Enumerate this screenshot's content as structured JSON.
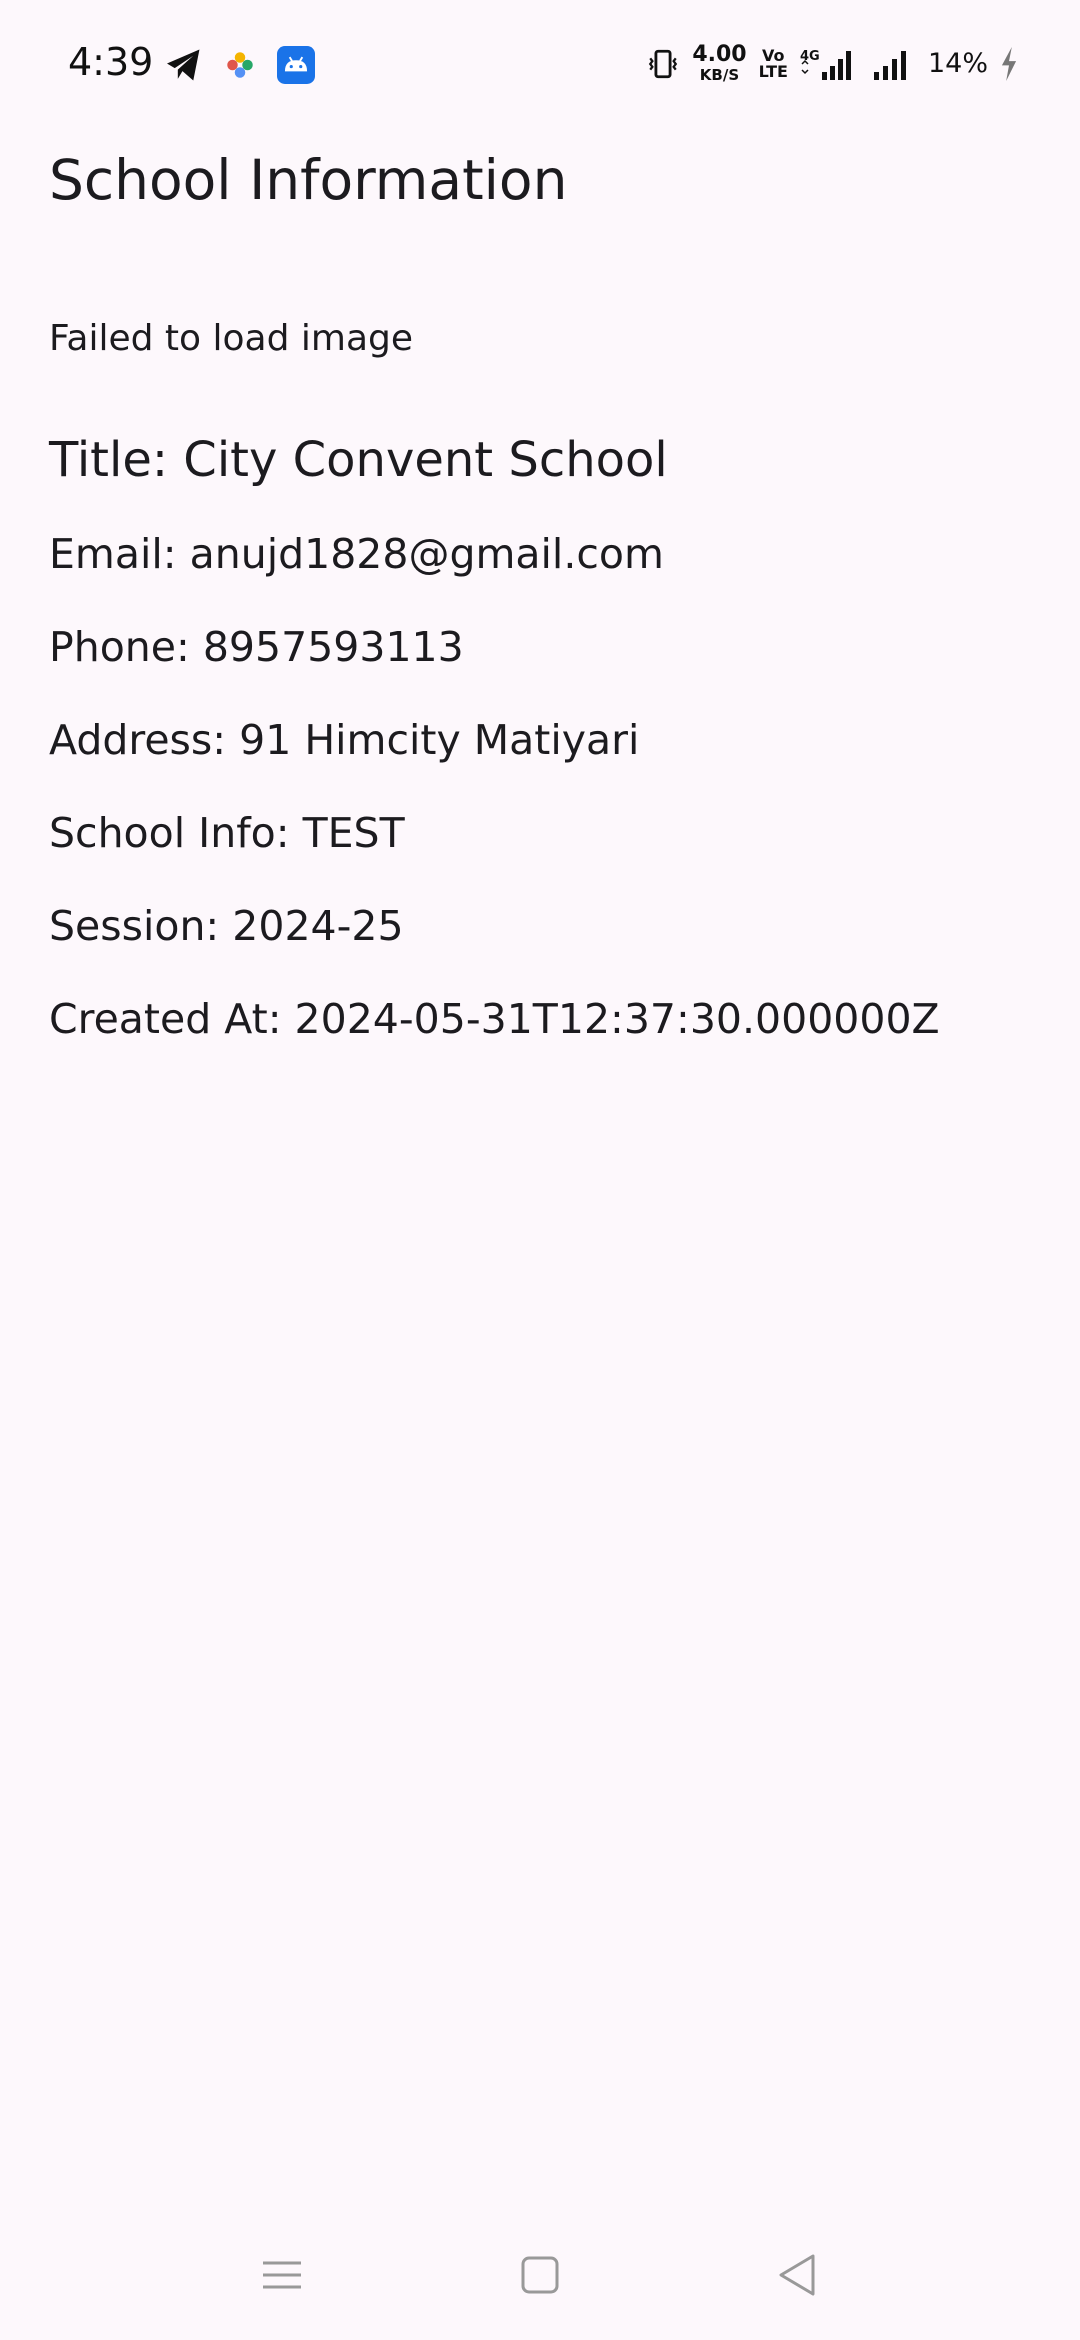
{
  "status_bar": {
    "time": "4:39",
    "left_icons": [
      "telegram-icon",
      "photos-icon",
      "android-app-icon"
    ],
    "net_speed_value": "4.00",
    "net_speed_unit": "KB/S",
    "volte_top": "Vo",
    "volte_bottom": "LTE",
    "network_type": "4G",
    "battery": "14%"
  },
  "app_bar": {
    "title": "School Information"
  },
  "image_error": "Failed to load image",
  "school": {
    "title_line": "Title: City Convent School",
    "email_line": "Email: anujd1828@gmail.com",
    "phone_line": "Phone: 8957593113",
    "address_line": "Address: 91 Himcity Matiyari",
    "info_line": "School Info: TEST",
    "session_line": "Session: 2024-25",
    "created_line": "Created At: 2024-05-31T12:37:30.000000Z"
  },
  "nav_bar": {
    "buttons": [
      "menu-icon",
      "home-icon",
      "back-icon"
    ]
  },
  "colors": {
    "background": "#fdf8fc",
    "text": "#1c1b1f",
    "android_badge": "#1a73e8"
  }
}
